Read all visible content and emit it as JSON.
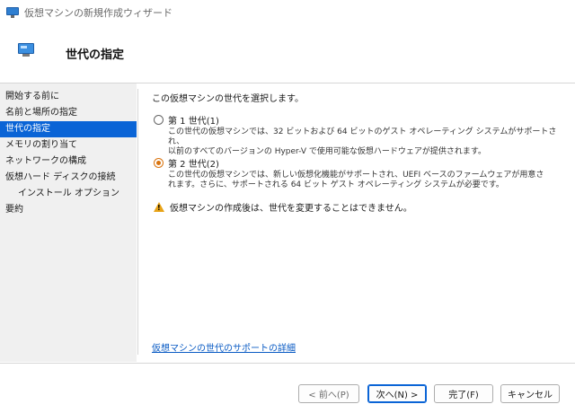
{
  "window": {
    "title": "仮想マシンの新規作成ウィザード"
  },
  "header": {
    "title": "世代の指定"
  },
  "sidebar": {
    "items": [
      {
        "label": "開始する前に"
      },
      {
        "label": "名前と場所の指定"
      },
      {
        "label": "世代の指定"
      },
      {
        "label": "メモリの割り当て"
      },
      {
        "label": "ネットワークの構成"
      },
      {
        "label": "仮想ハード ディスクの接続"
      },
      {
        "label": "インストール オプション"
      },
      {
        "label": "要約"
      }
    ],
    "active_index": 2
  },
  "main": {
    "prompt": "この仮想マシンの世代を選択します。",
    "gen1": {
      "label": "第 1 世代(1)",
      "line1": "この世代の仮想マシンでは、32 ビットおよび 64 ビットのゲスト オペレーティング システムがサポートされ、",
      "line2": "以前のすべてのバージョンの Hyper-V で使用可能な仮想ハードウェアが提供されます。",
      "selected": false
    },
    "gen2": {
      "label": "第 2 世代(2)",
      "line1": "この世代の仮想マシンでは、新しい仮想化機能がサポートされ、UEFI ベースのファームウェアが用意さ",
      "line2": "れます。さらに、サポートされる 64 ビット ゲスト オペレーティング システムが必要です。",
      "selected": true
    },
    "warning": "仮想マシンの作成後は、世代を変更することはできません。",
    "help_link": "仮想マシンの世代のサポートの詳細"
  },
  "footer": {
    "prev": "< 前へ(P)",
    "next": "次へ(N) >",
    "finish": "完了(F)",
    "cancel": "キャンセル"
  },
  "colors": {
    "accent": "#0a64d6",
    "radio_selected": "#d9730d",
    "warning": "#e8a317",
    "link": "#0a5bc4"
  }
}
